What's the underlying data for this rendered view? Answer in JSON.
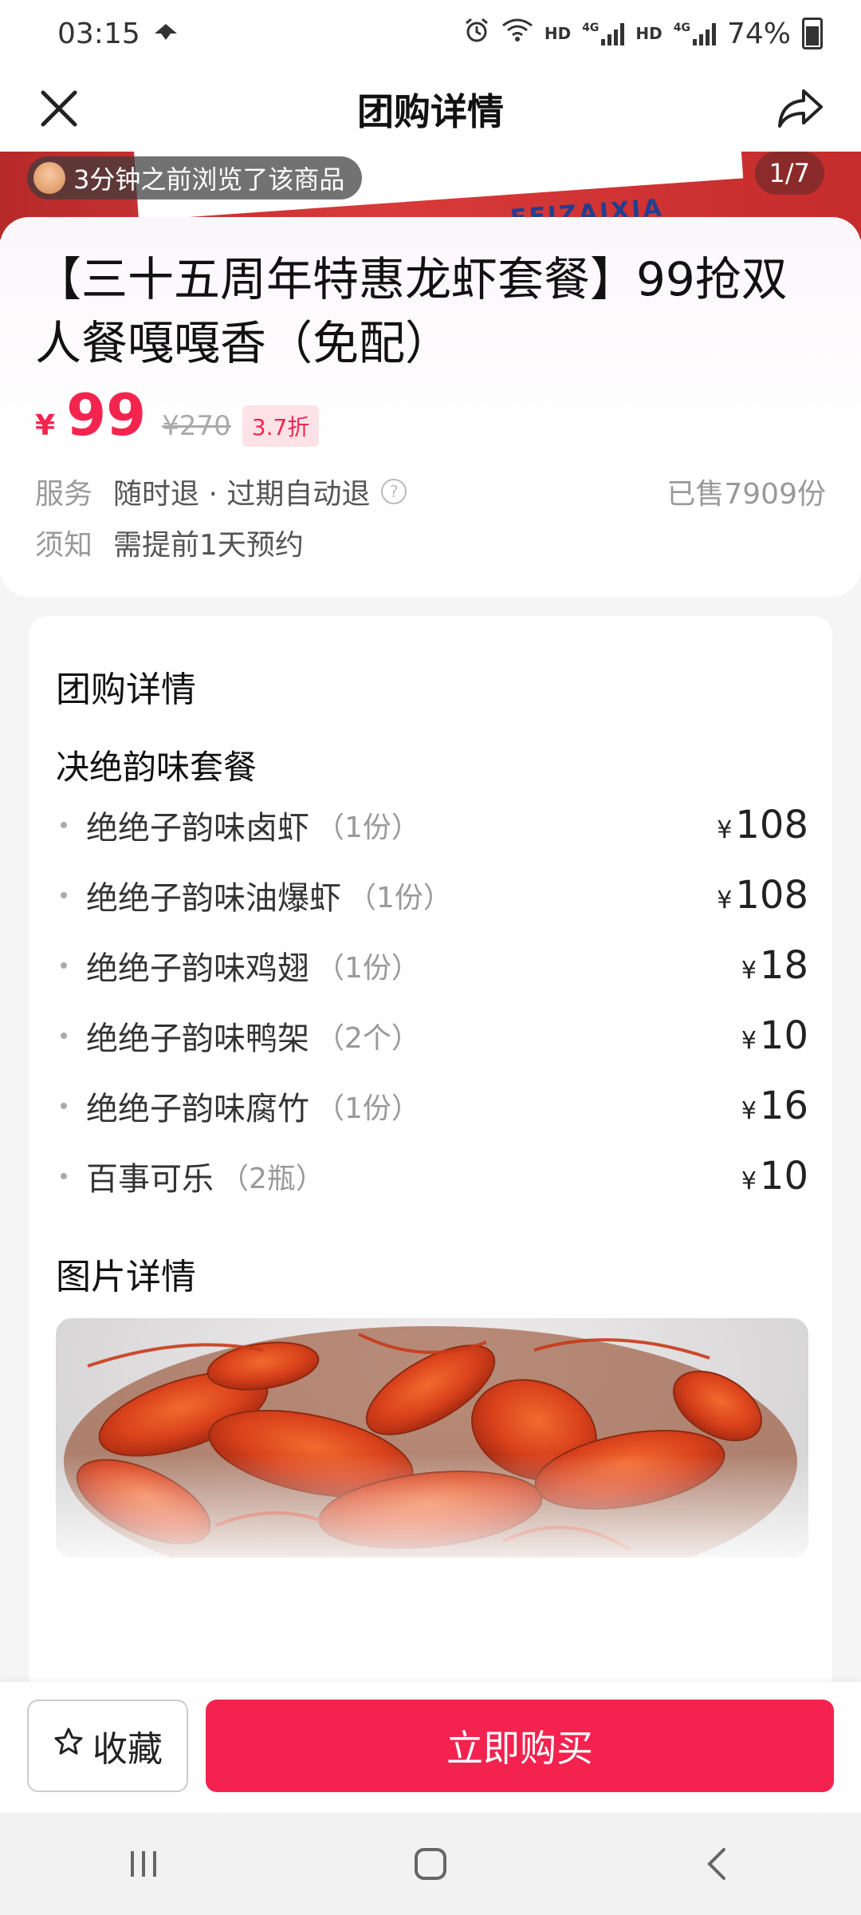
{
  "status_bar": {
    "time": "03:15",
    "network_labels": [
      "HD",
      "4G",
      "HD",
      "4G"
    ],
    "battery": "74%"
  },
  "nav": {
    "title": "团购详情",
    "close_icon": "close-icon",
    "share_icon": "share-icon"
  },
  "hero": {
    "viewed_text": "3分钟之前浏览了该商品",
    "counter": "1/7",
    "banner_text": "FEIZAIXIA"
  },
  "product": {
    "title": "【三十五周年特惠龙虾套餐】99抢双人餐嘎嘎香（免配）",
    "price_symbol": "¥",
    "price": "99",
    "original_price": "¥270",
    "discount": "3.7折",
    "service_label": "服务",
    "service_text": "随时退 · 过期自动退",
    "sold": "已售7909份",
    "notice_label": "须知",
    "notice_text": "需提前1天预约"
  },
  "details": {
    "section_title": "团购详情",
    "package_title": "决绝韵味套餐",
    "items": [
      {
        "name": "绝绝子韵味卤虾",
        "qty": "（1份）",
        "symbol": "¥",
        "price": "108"
      },
      {
        "name": "绝绝子韵味油爆虾",
        "qty": "（1份）",
        "symbol": "¥",
        "price": "108"
      },
      {
        "name": "绝绝子韵味鸡翅",
        "qty": "（1份）",
        "symbol": "¥",
        "price": "18"
      },
      {
        "name": "绝绝子韵味鸭架",
        "qty": "（2个）",
        "symbol": "¥",
        "price": "10"
      },
      {
        "name": "绝绝子韵味腐竹",
        "qty": "（1份）",
        "symbol": "¥",
        "price": "16"
      },
      {
        "name": "百事可乐",
        "qty": "（2瓶）",
        "symbol": "¥",
        "price": "10"
      }
    ],
    "photo_title": "图片详情"
  },
  "actions": {
    "favorite_label": "收藏",
    "buy_label": "立即购买"
  },
  "colors": {
    "accent": "#f4224f",
    "price": "#f3254e",
    "hero_red": "#c52c2c"
  }
}
